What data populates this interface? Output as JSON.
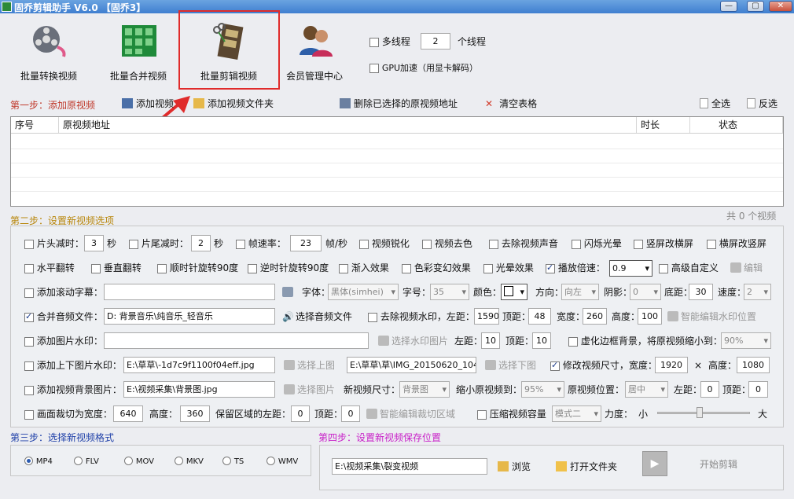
{
  "app": {
    "title": "固乔剪辑助手 V6.0 【固乔3】"
  },
  "window_controls": {
    "minimize": "—",
    "restore": "▢",
    "close": "✕"
  },
  "top_buttons": [
    {
      "label": "批量转换视频",
      "icon": "film-reel-icon"
    },
    {
      "label": "批量合并视频",
      "icon": "film-grid-icon"
    },
    {
      "label": "批量剪辑视频",
      "icon": "film-scissors-icon"
    },
    {
      "label": "会员管理中心",
      "icon": "users-icon"
    }
  ],
  "threads": {
    "multi_label": "多线程",
    "count": "2",
    "unit": "个线程",
    "gpu_label": "GPU加速（用显卡解码）"
  },
  "step1": {
    "label": "第一步：添加原视频",
    "toolbar": {
      "add_video": "添加视频",
      "add_folder": "添加视频文件夹",
      "delete_selected": "删除已选择的原视频地址",
      "clear_table": "清空表格",
      "select_all": "全选",
      "invert": "反选"
    },
    "columns": {
      "index": "序号",
      "path": "原视频地址",
      "duration": "时长",
      "status": "状态"
    },
    "count": "共 0 个视频"
  },
  "step2": {
    "label": "第二步：设置新视频选项",
    "row1": {
      "head_cut": "片头减时：",
      "head_val": "3",
      "sec1": "秒",
      "tail_cut": "片尾减时：",
      "tail_val": "2",
      "sec2": "秒",
      "fps": "帧速率：",
      "fps_val": "23",
      "fps_unit": "帧/秒",
      "sharpen": "视频锐化",
      "decolor": "视频去色",
      "remove_audio": "去除视频声音",
      "flash": "闪烁光晕",
      "v2h": "竖屏改横屏",
      "h2v": "横屏改竖屏"
    },
    "row2": {
      "hflip": "水平翻转",
      "vflip": "垂直翻转",
      "rot_cw": "顺时针旋转90度",
      "rot_ccw": "逆时针旋转90度",
      "fade_in": "渐入效果",
      "color_fx": "色彩变幻效果",
      "halo": "光晕效果",
      "speed": "播放倍速：",
      "speed_val": "0.9",
      "custom": "高级自定义",
      "edit": "编辑"
    },
    "row3": {
      "subtitle": "添加滚动字幕：",
      "font": "字体：",
      "font_val": "黑体(simhei)",
      "size": "字号：",
      "size_val": "35",
      "color": "颜色：",
      "direction": "方向：",
      "direction_val": "向左",
      "shadow": "阴影：",
      "shadow_val": "0",
      "bottom": "底距：",
      "bottom_val": "30",
      "speed": "速度：",
      "speed_val": "2"
    },
    "row4": {
      "merge_audio": "合并音频文件：",
      "audio_path": "D:        背景音乐\\纯音乐_轻音乐",
      "choose_audio": "选择音频文件",
      "remove_wm": "去除视频水印，左距：",
      "left_val": "1590",
      "top": "顶距：",
      "top_val": "48",
      "width": "宽度：",
      "width_val": "260",
      "height": "高度：",
      "height_val": "100",
      "smart_wm": "智能编辑水印位置"
    },
    "row5": {
      "img_wm": "添加图片水印：",
      "choose_wm": "选择水印图片",
      "left": "左距：",
      "left_val": "10",
      "top": "顶距：",
      "top_val": "10",
      "blur_bg": "虚化边框背景，将原视频缩小到：",
      "scale_val": "90%"
    },
    "row6": {
      "topbottom": "添加上下图片水印：",
      "top_path": "E:\\草草\\-1d7c9f1100f04eff.jpg",
      "choose_top": "选择上图",
      "bottom_path": "E:\\草草\\草\\IMG_20150620_104",
      "choose_bottom": "选择下图",
      "resize": "修改视频尺寸，宽度：",
      "w_val": "1920",
      "x": "×",
      "h_label": "高度：",
      "h_val": "1080"
    },
    "row7": {
      "bg_img": "添加视频背景图片：",
      "bg_path": "E:\\视频采集\\背景图.jpg",
      "choose_img": "选择图片",
      "new_size": "新视频尺寸：",
      "new_size_val": "背景图",
      "shrink": "缩小原视频到：",
      "shrink_val": "95%",
      "pos": "原视频位置：",
      "pos_val": "居中",
      "left": "左距：",
      "left_val": "0",
      "top": "顶距：",
      "top_val": "0"
    },
    "row8": {
      "crop": "画面裁切为宽度：",
      "crop_w": "640",
      "height": "高度：",
      "crop_h": "360",
      "keep_left": "保留区域的左距：",
      "keep_left_val": "0",
      "top": "顶距：",
      "top_val": "0",
      "smart_crop": "智能编辑裁切区域",
      "compress": "压缩视频容量",
      "compress_mode": "模式二",
      "strength": "力度：",
      "small": "小",
      "large": "大"
    }
  },
  "step3": {
    "label": "第三步：选择新视频格式",
    "formats": [
      "MP4",
      "FLV",
      "MOV",
      "MKV",
      "TS",
      "WMV"
    ],
    "selected": "MP4"
  },
  "step4": {
    "label": "第四步：设置新视频保存位置",
    "path": "E:\\视频采集\\裂变视频",
    "browse": "浏览",
    "open_folder": "打开文件夹",
    "start": "开始剪辑"
  },
  "colors": {
    "step_red": "#c0392b",
    "step_orange": "#b8860b",
    "step_blue": "#1e3fa8",
    "step_magenta": "#c81fc8",
    "highlight": "#e02b2b"
  }
}
